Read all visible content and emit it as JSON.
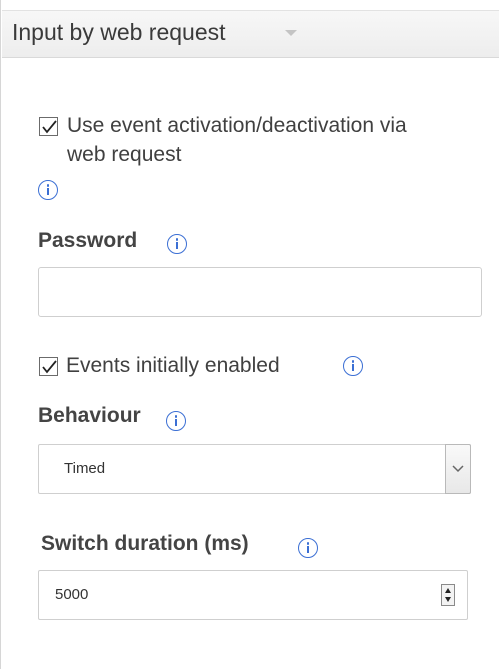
{
  "header": {
    "title": "Input by web request",
    "collapse_icon": "chevron-down-icon"
  },
  "use_event_activation": {
    "checked": true,
    "label_line1": "Use event activation/deactivation via",
    "label_line2": "web request",
    "info_icon": "info-icon"
  },
  "password": {
    "label": "Password",
    "value": "",
    "placeholder": "",
    "info_icon": "info-icon"
  },
  "events_initially_enabled": {
    "checked": true,
    "label": "Events initially enabled",
    "info_icon": "info-icon"
  },
  "behaviour": {
    "label": "Behaviour",
    "selected": "Timed",
    "dropdown_icon": "chevron-down-icon",
    "info_icon": "info-icon"
  },
  "switch_duration": {
    "label": "Switch duration (ms)",
    "value": "5000",
    "spinner_icon": "spinner-arrows-icon",
    "info_icon": "info-icon"
  },
  "colors": {
    "info_blue": "#3b6fd4",
    "header_bg": "#efefef",
    "border": "#cfcfcf"
  }
}
